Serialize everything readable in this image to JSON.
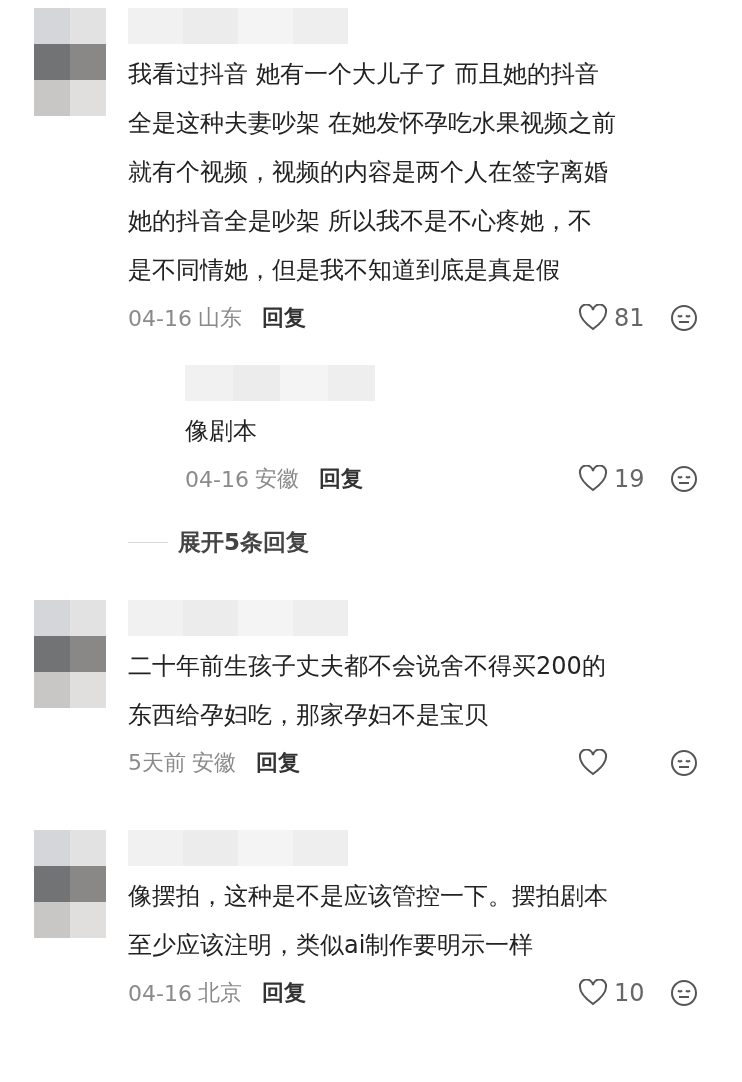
{
  "comments": [
    {
      "lines": [
        "我看过抖音  她有一个大儿子了  而且她的抖音",
        "全是这种夫妻吵架 在她发怀孕吃水果视频之前",
        "就有个视频，视频的内容是两个人在签字离婚",
        "她的抖音全是吵架  所以我不是不心疼她，不",
        "是不同情她，但是我不知道到底是真是假"
      ],
      "date": "04-16",
      "location": "山东",
      "reply_label": "回复",
      "liked": false,
      "likes": "81",
      "replies": [
        {
          "lines": [
            "像剧本"
          ],
          "date": "04-16",
          "location": "安徽",
          "reply_label": "回复",
          "liked": false,
          "likes": "19"
        }
      ],
      "expand_label": "展开5条回复"
    },
    {
      "lines": [
        "二十年前生孩子丈夫都不会说舍不得买200的",
        "东西给孕妇吃，那家孕妇不是宝贝"
      ],
      "date": "5天前",
      "location": "安徽",
      "reply_label": "回复",
      "liked": false
    },
    {
      "lines": [
        "像摆拍，这种是不是应该管控一下。摆拍剧本",
        "至少应该注明，类似ai制作要明示一样"
      ],
      "date": "04-16",
      "location": "北京",
      "reply_label": "回复",
      "liked": false,
      "likes": "10"
    }
  ]
}
